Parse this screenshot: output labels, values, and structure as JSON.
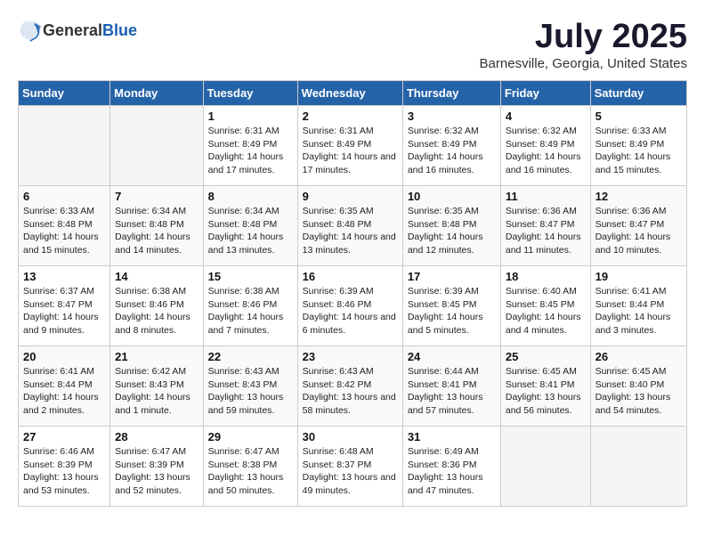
{
  "header": {
    "logo_general": "General",
    "logo_blue": "Blue",
    "title": "July 2025",
    "subtitle": "Barnesville, Georgia, United States"
  },
  "days_of_week": [
    "Sunday",
    "Monday",
    "Tuesday",
    "Wednesday",
    "Thursday",
    "Friday",
    "Saturday"
  ],
  "weeks": [
    [
      {
        "day": "",
        "info": ""
      },
      {
        "day": "",
        "info": ""
      },
      {
        "day": "1",
        "info": "Sunrise: 6:31 AM\nSunset: 8:49 PM\nDaylight: 14 hours and 17 minutes."
      },
      {
        "day": "2",
        "info": "Sunrise: 6:31 AM\nSunset: 8:49 PM\nDaylight: 14 hours and 17 minutes."
      },
      {
        "day": "3",
        "info": "Sunrise: 6:32 AM\nSunset: 8:49 PM\nDaylight: 14 hours and 16 minutes."
      },
      {
        "day": "4",
        "info": "Sunrise: 6:32 AM\nSunset: 8:49 PM\nDaylight: 14 hours and 16 minutes."
      },
      {
        "day": "5",
        "info": "Sunrise: 6:33 AM\nSunset: 8:49 PM\nDaylight: 14 hours and 15 minutes."
      }
    ],
    [
      {
        "day": "6",
        "info": "Sunrise: 6:33 AM\nSunset: 8:48 PM\nDaylight: 14 hours and 15 minutes."
      },
      {
        "day": "7",
        "info": "Sunrise: 6:34 AM\nSunset: 8:48 PM\nDaylight: 14 hours and 14 minutes."
      },
      {
        "day": "8",
        "info": "Sunrise: 6:34 AM\nSunset: 8:48 PM\nDaylight: 14 hours and 13 minutes."
      },
      {
        "day": "9",
        "info": "Sunrise: 6:35 AM\nSunset: 8:48 PM\nDaylight: 14 hours and 13 minutes."
      },
      {
        "day": "10",
        "info": "Sunrise: 6:35 AM\nSunset: 8:48 PM\nDaylight: 14 hours and 12 minutes."
      },
      {
        "day": "11",
        "info": "Sunrise: 6:36 AM\nSunset: 8:47 PM\nDaylight: 14 hours and 11 minutes."
      },
      {
        "day": "12",
        "info": "Sunrise: 6:36 AM\nSunset: 8:47 PM\nDaylight: 14 hours and 10 minutes."
      }
    ],
    [
      {
        "day": "13",
        "info": "Sunrise: 6:37 AM\nSunset: 8:47 PM\nDaylight: 14 hours and 9 minutes."
      },
      {
        "day": "14",
        "info": "Sunrise: 6:38 AM\nSunset: 8:46 PM\nDaylight: 14 hours and 8 minutes."
      },
      {
        "day": "15",
        "info": "Sunrise: 6:38 AM\nSunset: 8:46 PM\nDaylight: 14 hours and 7 minutes."
      },
      {
        "day": "16",
        "info": "Sunrise: 6:39 AM\nSunset: 8:46 PM\nDaylight: 14 hours and 6 minutes."
      },
      {
        "day": "17",
        "info": "Sunrise: 6:39 AM\nSunset: 8:45 PM\nDaylight: 14 hours and 5 minutes."
      },
      {
        "day": "18",
        "info": "Sunrise: 6:40 AM\nSunset: 8:45 PM\nDaylight: 14 hours and 4 minutes."
      },
      {
        "day": "19",
        "info": "Sunrise: 6:41 AM\nSunset: 8:44 PM\nDaylight: 14 hours and 3 minutes."
      }
    ],
    [
      {
        "day": "20",
        "info": "Sunrise: 6:41 AM\nSunset: 8:44 PM\nDaylight: 14 hours and 2 minutes."
      },
      {
        "day": "21",
        "info": "Sunrise: 6:42 AM\nSunset: 8:43 PM\nDaylight: 14 hours and 1 minute."
      },
      {
        "day": "22",
        "info": "Sunrise: 6:43 AM\nSunset: 8:43 PM\nDaylight: 13 hours and 59 minutes."
      },
      {
        "day": "23",
        "info": "Sunrise: 6:43 AM\nSunset: 8:42 PM\nDaylight: 13 hours and 58 minutes."
      },
      {
        "day": "24",
        "info": "Sunrise: 6:44 AM\nSunset: 8:41 PM\nDaylight: 13 hours and 57 minutes."
      },
      {
        "day": "25",
        "info": "Sunrise: 6:45 AM\nSunset: 8:41 PM\nDaylight: 13 hours and 56 minutes."
      },
      {
        "day": "26",
        "info": "Sunrise: 6:45 AM\nSunset: 8:40 PM\nDaylight: 13 hours and 54 minutes."
      }
    ],
    [
      {
        "day": "27",
        "info": "Sunrise: 6:46 AM\nSunset: 8:39 PM\nDaylight: 13 hours and 53 minutes."
      },
      {
        "day": "28",
        "info": "Sunrise: 6:47 AM\nSunset: 8:39 PM\nDaylight: 13 hours and 52 minutes."
      },
      {
        "day": "29",
        "info": "Sunrise: 6:47 AM\nSunset: 8:38 PM\nDaylight: 13 hours and 50 minutes."
      },
      {
        "day": "30",
        "info": "Sunrise: 6:48 AM\nSunset: 8:37 PM\nDaylight: 13 hours and 49 minutes."
      },
      {
        "day": "31",
        "info": "Sunrise: 6:49 AM\nSunset: 8:36 PM\nDaylight: 13 hours and 47 minutes."
      },
      {
        "day": "",
        "info": ""
      },
      {
        "day": "",
        "info": ""
      }
    ]
  ]
}
